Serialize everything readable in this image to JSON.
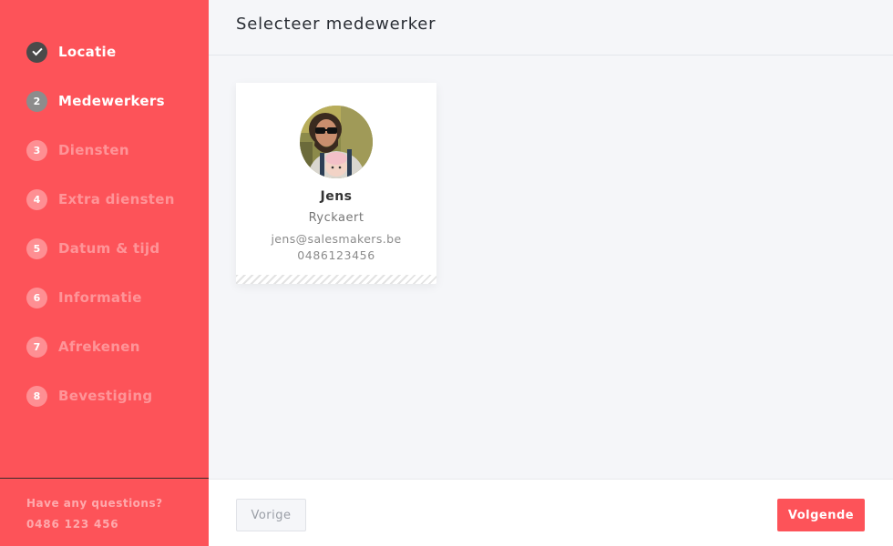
{
  "sidebar": {
    "steps": [
      {
        "num": "✓",
        "label": "Locatie",
        "state": "done"
      },
      {
        "num": "2",
        "label": "Medewerkers",
        "state": "active"
      },
      {
        "num": "3",
        "label": "Diensten",
        "state": "pending"
      },
      {
        "num": "4",
        "label": "Extra diensten",
        "state": "pending"
      },
      {
        "num": "5",
        "label": "Datum & tijd",
        "state": "pending"
      },
      {
        "num": "6",
        "label": "Informatie",
        "state": "pending"
      },
      {
        "num": "7",
        "label": "Afrekenen",
        "state": "pending"
      },
      {
        "num": "8",
        "label": "Bevestiging",
        "state": "pending"
      }
    ],
    "footer": {
      "question": "Have any questions?",
      "phone": "0486 123 456"
    }
  },
  "header": {
    "title": "Selecteer medewerker"
  },
  "staff": [
    {
      "first_name": "Jens",
      "last_name": "Ryckaert",
      "email": "jens@salesmakers.be",
      "phone": "0486123456",
      "avatar_icon": "person-photo-icon"
    }
  ],
  "footer": {
    "prev_label": "Vorige",
    "next_label": "Volgende"
  },
  "colors": {
    "accent": "#fd5359",
    "done": "#4a4a4a",
    "active": "#8c8c8c",
    "background": "#f5f6f9"
  }
}
